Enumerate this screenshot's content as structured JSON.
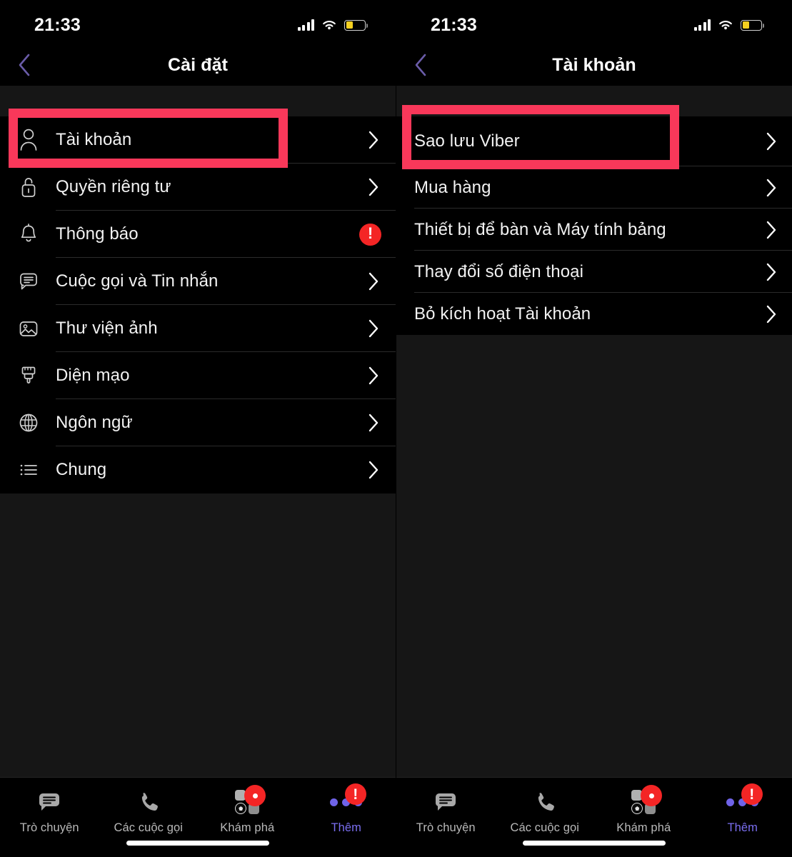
{
  "app": {
    "name": "Viber",
    "theme": "dark",
    "accent_color": "#7a6ef0",
    "alert_color": "#f42525",
    "highlight_color": "#f9385a"
  },
  "status_bar": {
    "time": "21:33",
    "cellular_icon": "cellular-bars-icon",
    "wifi_icon": "wifi-icon",
    "battery_icon": "battery-low-power-icon",
    "battery_color": "#f5d020"
  },
  "left_panel": {
    "nav": {
      "back_icon": "chevron-left-icon",
      "title": "Cài đặt"
    },
    "items": [
      {
        "icon": "person-icon",
        "label": "Tài khoản",
        "accessory": "chevron",
        "highlighted": true
      },
      {
        "icon": "lock-open-icon",
        "label": "Quyền riêng tư",
        "accessory": "chevron",
        "highlighted": false
      },
      {
        "icon": "bell-icon",
        "label": "Thông báo",
        "accessory": "alert",
        "highlighted": false
      },
      {
        "icon": "chat-bubble-icon",
        "label": "Cuộc gọi và Tin nhắn",
        "accessory": "chevron",
        "highlighted": false
      },
      {
        "icon": "photo-icon",
        "label": "Thư viện ảnh",
        "accessory": "chevron",
        "highlighted": false
      },
      {
        "icon": "paintbrush-icon",
        "label": "Diện mạo",
        "accessory": "chevron",
        "highlighted": false
      },
      {
        "icon": "globe-icon",
        "label": "Ngôn ngữ",
        "accessory": "chevron",
        "highlighted": false
      },
      {
        "icon": "list-icon",
        "label": "Chung",
        "accessory": "chevron",
        "highlighted": false
      }
    ]
  },
  "right_panel": {
    "nav": {
      "back_icon": "chevron-left-icon",
      "title": "Tài khoản"
    },
    "items": [
      {
        "label": "Sao lưu Viber",
        "accessory": "chevron",
        "highlighted": true
      },
      {
        "label": "Mua hàng",
        "accessory": "chevron",
        "highlighted": false
      },
      {
        "label": "Thiết bị để bàn và Máy tính bảng",
        "accessory": "chevron",
        "highlighted": false
      },
      {
        "label": "Thay đổi số điện thoại",
        "accessory": "chevron",
        "highlighted": false
      },
      {
        "label": "Bỏ kích hoạt Tài khoản",
        "accessory": "chevron",
        "highlighted": false
      }
    ]
  },
  "tab_bar": {
    "tabs": [
      {
        "icon": "chat-bubble-icon",
        "label": "Trò chuyện",
        "active": false,
        "badge": null
      },
      {
        "icon": "phone-icon",
        "label": "Các cuộc gọi",
        "active": false,
        "badge": null
      },
      {
        "icon": "explore-grid-icon",
        "label": "Khám phá",
        "active": false,
        "badge": "dot"
      },
      {
        "icon": "more-dots-icon",
        "label": "Thêm",
        "active": true,
        "badge": "!"
      }
    ]
  }
}
